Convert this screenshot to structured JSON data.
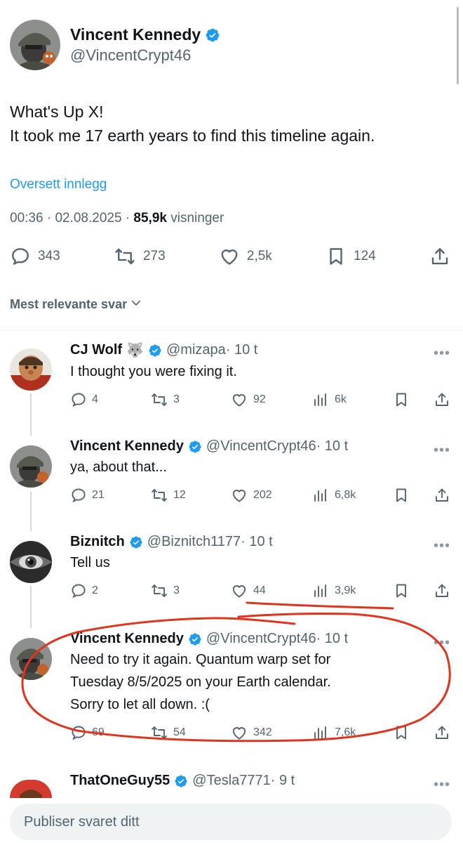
{
  "main_tweet": {
    "display_name": "Vincent Kennedy",
    "handle": "@VincentCrypt46",
    "text_line_1": "What's Up X!",
    "text_line_2": "It took me 17 earth years to find this timeline again.",
    "translate_label": "Oversett innlegg",
    "time": "00:36",
    "date": "02.08.2025",
    "separator": "·",
    "views": "85,9k",
    "views_label": "visninger",
    "stats": {
      "replies": "343",
      "reposts": "273",
      "likes": "2,5k",
      "bookmarks": "124"
    }
  },
  "sort_label": "Mest relevante svar",
  "replies": [
    {
      "display_name": "CJ Wolf",
      "emoji": "🐺",
      "handle": "@mizapa",
      "time": "· 10 t",
      "text": "I thought you were fixing it.",
      "replies": "4",
      "reposts": "3",
      "likes": "92",
      "views": "6k"
    },
    {
      "display_name": "Vincent Kennedy",
      "handle": "@VincentCrypt46",
      "time": "· 10 t",
      "text": "ya, about that...",
      "replies": "21",
      "reposts": "12",
      "likes": "202",
      "views": "6,8k"
    },
    {
      "display_name": "Biznitch",
      "handle": "@Biznitch1177",
      "time": "· 10 t",
      "text": "Tell us",
      "replies": "2",
      "reposts": "3",
      "likes": "44",
      "views": "3,9k"
    },
    {
      "display_name": "Vincent Kennedy",
      "handle": "@VincentCrypt46",
      "time": "· 10 t",
      "text_line_1": "Need to try it again. Quantum warp set for",
      "text_line_2": "Tuesday 8/5/2025 on your Earth calendar.",
      "text_line_3": "Sorry to let all down. :(",
      "replies": "69",
      "reposts": "54",
      "likes": "342",
      "views": "7,6k"
    },
    {
      "display_name": "ThatOneGuy55",
      "handle": "@Tesla7771",
      "time": "· 9 t"
    }
  ],
  "composer": {
    "placeholder": "Publiser svaret ditt"
  },
  "icons": {
    "verified": "verified-badge-icon",
    "reply": "speech-bubble-icon",
    "repost": "repost-arrows-icon",
    "like": "heart-icon",
    "views": "bar-chart-icon",
    "bookmark": "bookmark-icon",
    "share": "share-upload-icon",
    "more": "more-dots-icon",
    "chevron": "chevron-down-icon"
  },
  "colors": {
    "accent": "#1d9bf0",
    "text": "#0f1419",
    "secondary": "#536471",
    "annotation": "#e0351c"
  }
}
